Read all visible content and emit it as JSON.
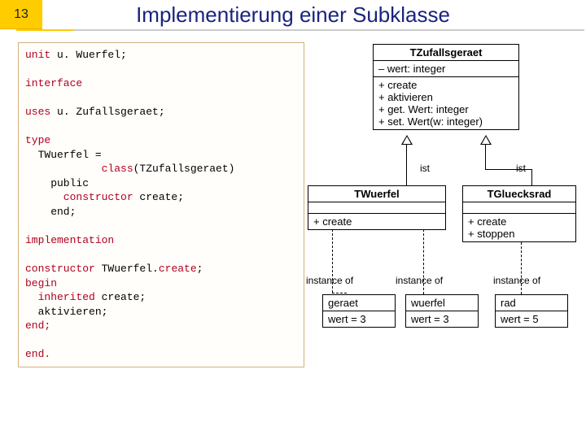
{
  "slide": {
    "number": "13",
    "title": "Implementierung einer Subklasse"
  },
  "code": {
    "l1a": "unit",
    "l1b": " u. Wuerfel;",
    "l2a": "interface",
    "l3a": "uses",
    "l3b": " u. Zufallsgeraet;",
    "l4a": "type",
    "l5": "  TWuerfel =",
    "l6a": "            class",
    "l6b": "(TZufallsgeraet)",
    "l7": "    public",
    "l8a": "      constructor",
    "l8b": " create;",
    "l9": "    end;",
    "l10a": "implementation",
    "l11a": "constructor",
    "l11b": " TWuerfel.",
    "l11c": "create",
    "l11d": ";",
    "l12a": "begin",
    "l13a": "  inherited",
    "l13b": " create;",
    "l14": "  aktivieren;",
    "l15a": "end;",
    "l16a": "end."
  },
  "uml": {
    "parent": {
      "name": "TZufallsgeraet",
      "attrs": "– wert: integer",
      "m1": "+ create",
      "m2": "+ aktivieren",
      "m3": "+ get. Wert: integer",
      "m4": "+ set. Wert(w: integer)"
    },
    "childL": {
      "name": "TWuerfel",
      "m1": "+ create"
    },
    "childR": {
      "name": "TGluecksrad",
      "m1": "+ create",
      "m2": "+ stoppen"
    },
    "ist1": "ist",
    "ist2": "ist",
    "inst1": "instance of",
    "inst2": "instance of",
    "inst3": "instance of",
    "obj1": {
      "name": "geraet",
      "val": "wert = 3"
    },
    "obj2": {
      "name": "wuerfel",
      "val": "wert = 3"
    },
    "obj3": {
      "name": "rad",
      "val": "wert = 5"
    }
  }
}
